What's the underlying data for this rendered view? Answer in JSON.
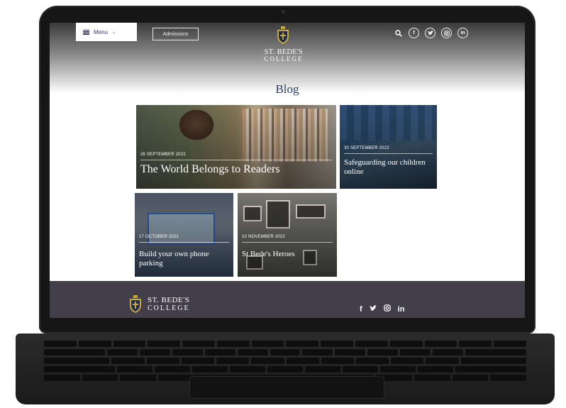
{
  "header": {
    "menu_label": "Menu",
    "admissions_label": "Admissions",
    "brand_top": "ST. BEDE'S",
    "brand_bottom": "COLLEGE",
    "social": [
      {
        "icon": "facebook-icon",
        "glyph": "f"
      },
      {
        "icon": "twitter-icon",
        "glyph": "t"
      },
      {
        "icon": "instagram-icon",
        "glyph": "◎"
      },
      {
        "icon": "linkedin-icon",
        "glyph": "in"
      }
    ]
  },
  "blog": {
    "title": "Blog",
    "posts": [
      {
        "date": "26 SEPTEMBER 2022",
        "title": "The World Belongs to Readers"
      },
      {
        "date": "30 SEPTEMBER 2022",
        "title": "Safeguarding our children online"
      },
      {
        "date": "17 OCTOBER 2022",
        "title": "Build your own phone parking"
      },
      {
        "date": "10 NOVEMBER 2022",
        "title": "St Bede's Heroes"
      }
    ]
  },
  "footer": {
    "brand_top": "ST. BEDE'S",
    "brand_bottom": "COLLEGE",
    "social": [
      {
        "icon": "facebook-icon",
        "glyph": "f"
      },
      {
        "icon": "twitter-icon",
        "glyph": "t"
      },
      {
        "icon": "instagram-icon",
        "glyph": "◎"
      },
      {
        "icon": "linkedin-icon",
        "glyph": "in"
      }
    ]
  },
  "colors": {
    "brand_navy": "#2e3d66",
    "footer_bg": "#423e4a",
    "crest_gold": "#c9a640"
  }
}
